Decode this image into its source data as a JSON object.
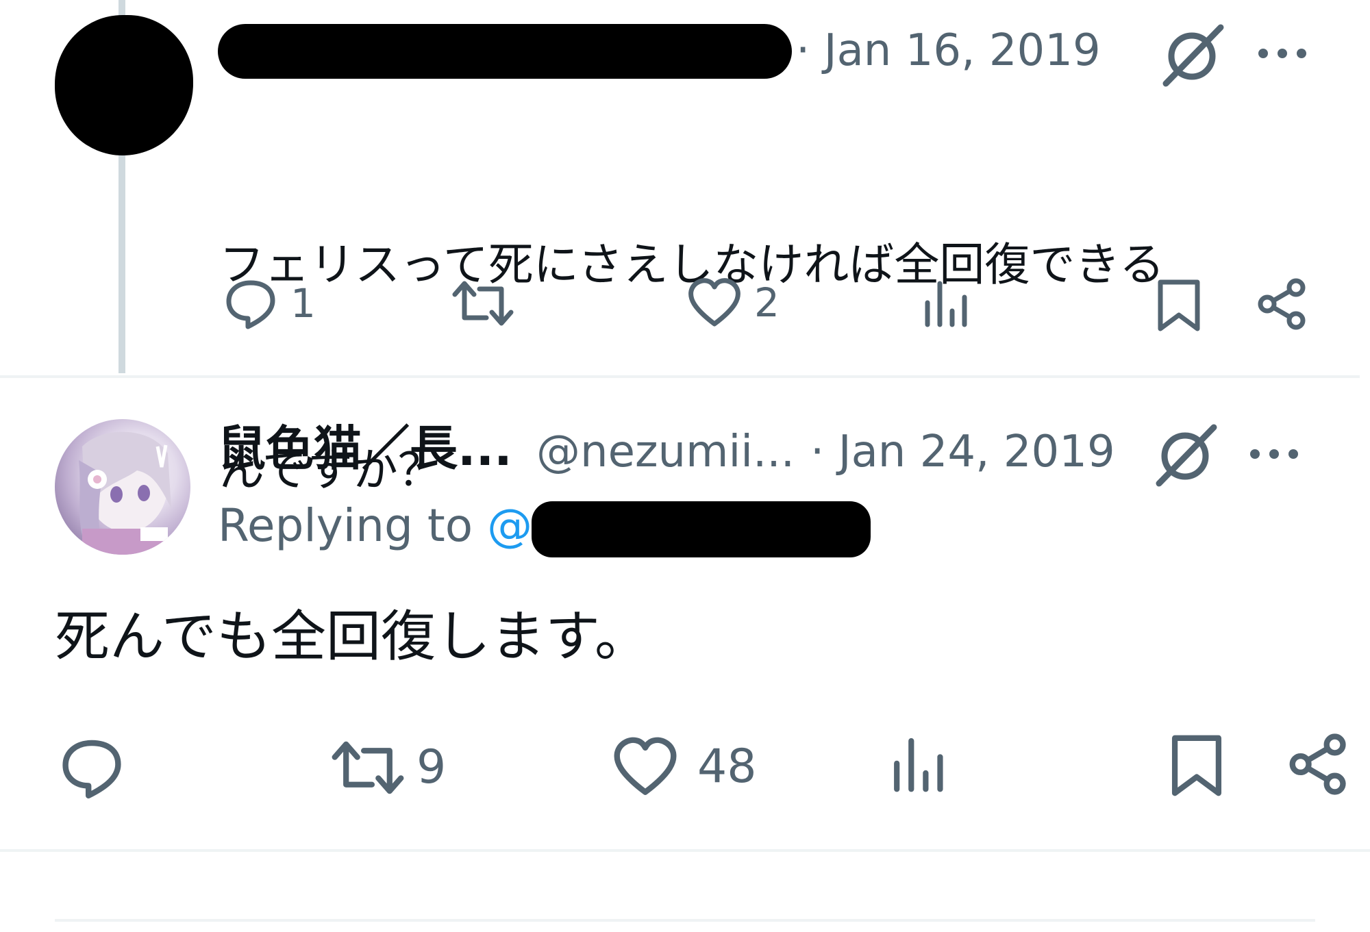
{
  "tweets": [
    {
      "date": "· Jan 16, 2019",
      "text": "フェリスって死にさえしなければ全回復できるんですか？",
      "text_lines": [
        "フェリスって死にさえしなければ全回復できる",
        "んですか？"
      ],
      "replies": "1",
      "retweets": "",
      "likes": "2"
    },
    {
      "display_name": "鼠色猫／長...",
      "handle": "@nezumii...",
      "date": "· Jan 24, 2019",
      "replying_label": "Replying to",
      "replying_at": "@",
      "text": "死んでも全回復します。",
      "replies": "",
      "retweets": "9",
      "likes": "48"
    }
  ],
  "icons": {
    "grok": "grok-icon",
    "more": "more-icon",
    "reply": "reply-icon",
    "retweet": "retweet-icon",
    "like": "like-icon",
    "views": "views-icon",
    "bookmark": "bookmark-icon",
    "share": "share-icon"
  },
  "colors": {
    "text": "#0f1419",
    "secondary": "#536471",
    "link": "#1d9bf0",
    "divider": "#eff3f4",
    "thread_line": "#cfd9de"
  }
}
